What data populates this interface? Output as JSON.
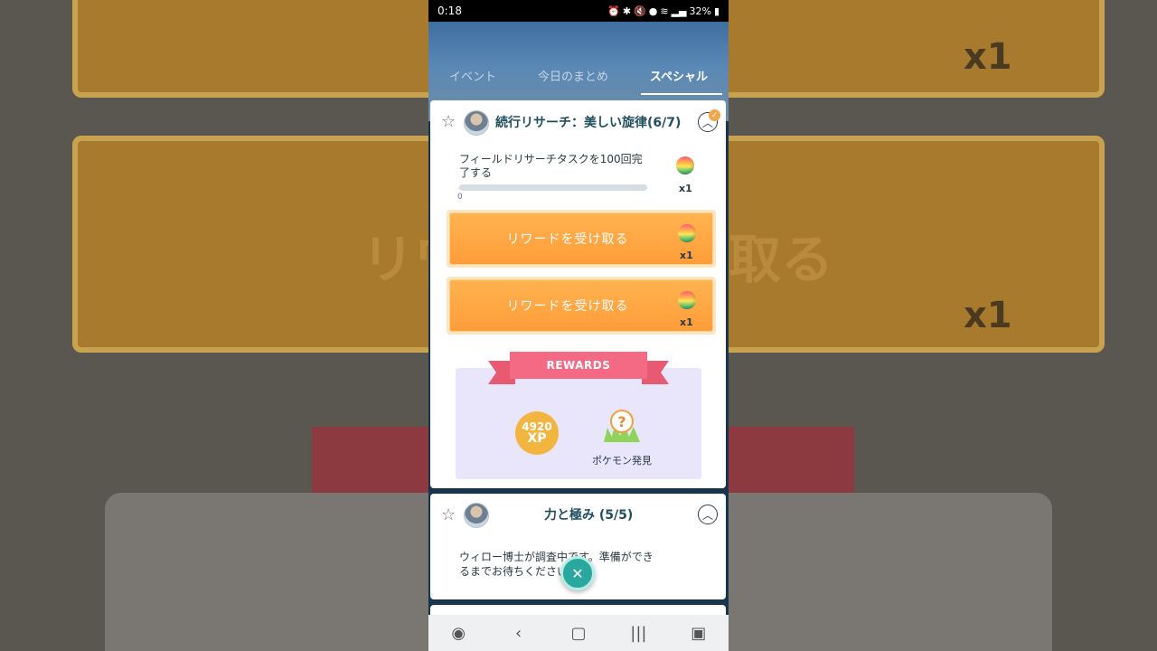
{
  "status": {
    "time": "0:18",
    "battery": "32%",
    "icons": [
      "alarm-icon",
      "bluetooth-icon",
      "mute-icon",
      "location-icon",
      "wifi-icon",
      "signal-icon",
      "battery-icon"
    ]
  },
  "tabs": [
    {
      "label": "イベント",
      "active": false
    },
    {
      "label": "今日のまとめ",
      "active": false
    },
    {
      "label": "スペシャル",
      "active": true
    }
  ],
  "research1": {
    "title": "続行リサーチ：美しい旋律(6/7)",
    "task": "フィールドリサーチタスクを100回完了する",
    "progress_value": "0",
    "progress_fraction": 0,
    "task_reward_qty": "x1",
    "reward_buttons": [
      {
        "label": "リワードを受け取る",
        "qty": "x1"
      },
      {
        "label": "リワードを受け取る",
        "qty": "x1"
      }
    ],
    "rewards_header": "REWARDS",
    "xp_amount": "4920",
    "xp_unit": "XP",
    "encounter_label": "ポケモン発見"
  },
  "research2": {
    "title": "力と極み (5/5)",
    "message": "ウィロー博士が調査中です。準備ができるまでお待ちください。"
  },
  "background": {
    "reward_text": "リワードを受け取る",
    "qty": "x1"
  },
  "colors": {
    "accent_orange": "#ff9d3a",
    "ribbon_pink": "#f46a84",
    "title_teal": "#1f4e5e",
    "close_teal": "#2aa8a0"
  }
}
